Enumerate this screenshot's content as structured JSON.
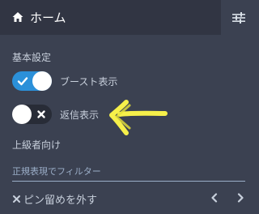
{
  "header": {
    "title": "ホーム",
    "home_icon": "home-icon",
    "settings_icon": "sliders-icon"
  },
  "sections": {
    "basic": "基本設定",
    "advanced": "上級者向け"
  },
  "toggles": {
    "boost": {
      "label": "ブースト表示",
      "state": "on"
    },
    "reply": {
      "label": "返信表示",
      "state": "off"
    }
  },
  "filter": {
    "placeholder": "正規表現でフィルター",
    "value": ""
  },
  "footer": {
    "unpin_label": "ピン留めを外す",
    "unpin_icon": "close-icon",
    "prev_icon": "chevron-left-icon",
    "next_icon": "chevron-right-icon"
  },
  "colors": {
    "panel": "#3b4151",
    "header": "#313543",
    "accent": "#2b90d9",
    "annotation": "#f6f04a"
  }
}
